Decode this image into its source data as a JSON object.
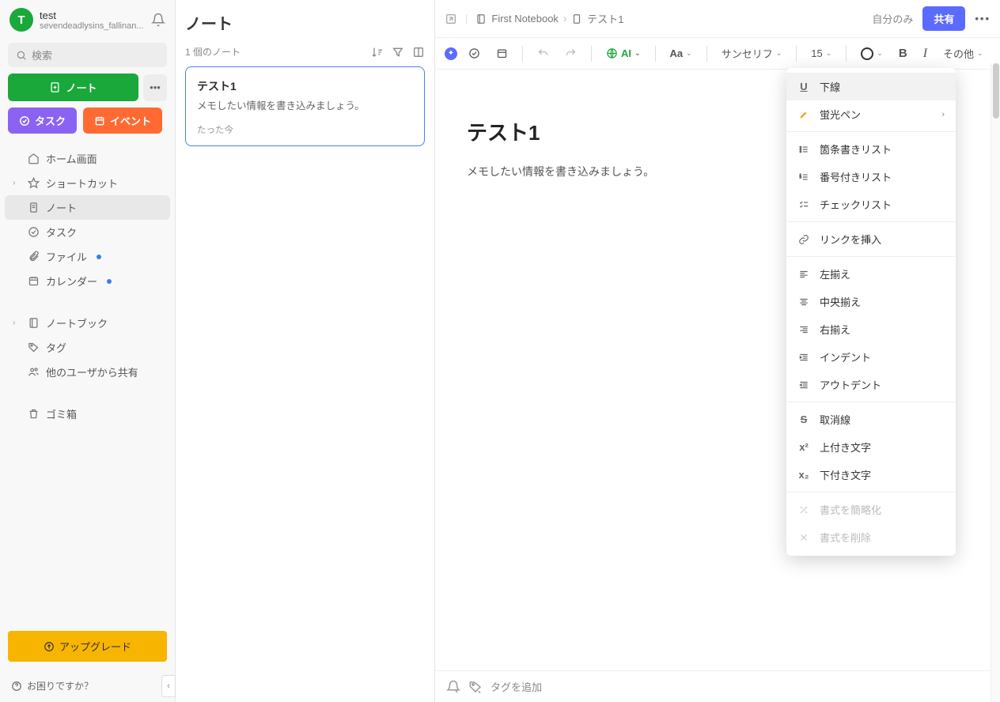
{
  "user": {
    "initial": "T",
    "name": "test",
    "sub": "sevendeadlysins_fallinan..."
  },
  "search": {
    "placeholder": "検索"
  },
  "buttons": {
    "note": "ノート",
    "task": "タスク",
    "event": "イベント",
    "upgrade": "アップグレード",
    "help": "お困りですか？"
  },
  "nav": {
    "home": "ホーム画面",
    "shortcuts": "ショートカット",
    "notes": "ノート",
    "tasks": "タスク",
    "files": "ファイル",
    "calendar": "カレンダー",
    "notebooks": "ノートブック",
    "tags": "タグ",
    "shared": "他のユーザから共有",
    "trash": "ゴミ箱"
  },
  "notelist": {
    "title": "ノート",
    "count": "1 個のノート"
  },
  "card": {
    "title": "テスト1",
    "body": "メモしたい情報を書き込みましょう。",
    "time": "たった今"
  },
  "breadcrumb": {
    "notebook": "First Notebook",
    "note": "テスト1"
  },
  "topbar": {
    "visibility": "自分のみ",
    "share": "共有"
  },
  "toolbar": {
    "ai": "AI",
    "fontBtn": "Aa",
    "fontFamily": "サンセリフ",
    "fontSize": "15",
    "other": "その他"
  },
  "editor": {
    "title": "テスト1",
    "body": "メモしたい情報を書き込みましょう。",
    "tagPlaceholder": "タグを追加"
  },
  "menu": {
    "underline": "下線",
    "highlight": "蛍光ペン",
    "bullet": "箇条書きリスト",
    "numbered": "番号付きリスト",
    "checklist": "チェックリスト",
    "link": "リンクを挿入",
    "alignLeft": "左揃え",
    "alignCenter": "中央揃え",
    "alignRight": "右揃え",
    "indent": "インデント",
    "outdent": "アウトデント",
    "strike": "取消線",
    "superscript": "上付き文字",
    "subscript": "下付き文字",
    "simplify": "書式を簡略化",
    "clear": "書式を削除"
  }
}
